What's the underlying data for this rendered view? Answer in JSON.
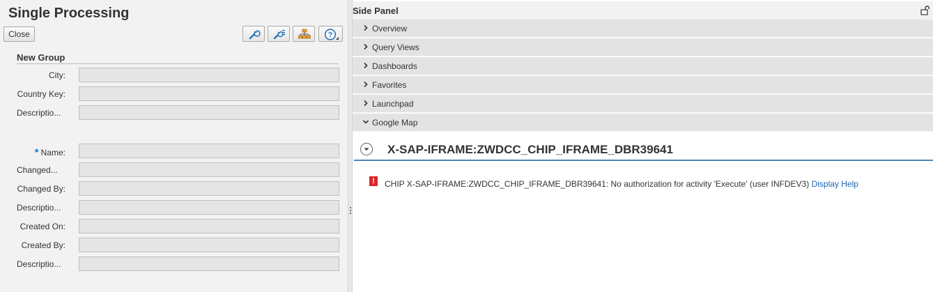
{
  "left": {
    "title": "Single Processing",
    "close_label": "Close",
    "toolbar_icons": [
      "wrench-icon",
      "wrench-list-icon",
      "hierarchy-icon",
      "help-icon"
    ],
    "group_title": "New Group",
    "fields": [
      {
        "label": "City:",
        "value": ""
      },
      {
        "label": "Country Key:",
        "value": ""
      },
      {
        "label": "Descriptio...",
        "value": ""
      },
      {
        "label": "Name:",
        "value": "",
        "required_marker": "*"
      },
      {
        "label": "Changed...",
        "value": ""
      },
      {
        "label": "Changed By:",
        "value": ""
      },
      {
        "label": "Descriptio...",
        "value": ""
      },
      {
        "label": "Created On:",
        "value": ""
      },
      {
        "label": "Created By:",
        "value": ""
      },
      {
        "label": "Descriptio...",
        "value": ""
      }
    ]
  },
  "side": {
    "title": "Side Panel",
    "sections": [
      {
        "label": "Overview",
        "expanded": false
      },
      {
        "label": "Query Views",
        "expanded": false
      },
      {
        "label": "Dashboards",
        "expanded": false
      },
      {
        "label": "Favorites",
        "expanded": false
      },
      {
        "label": "Launchpad",
        "expanded": false
      },
      {
        "label": "Google Map",
        "expanded": true
      }
    ],
    "chip": {
      "title": "X-SAP-IFRAME:ZWDCC_CHIP_IFRAME_DBR39641",
      "error_icon": "!",
      "error_text": "CHIP X-SAP-IFRAME:ZWDCC_CHIP_IFRAME_DBR39641: No authorization for activity 'Execute' (user INFDEV3)",
      "error_link": "Display Help"
    }
  },
  "colors": {
    "accent": "#0a6ed1",
    "link": "#1a63b0",
    "error": "#d9262a",
    "chip_rule": "#4a87b8",
    "panel_bg": "#f2f2f2",
    "accordion_bg": "#e3e3e3"
  }
}
